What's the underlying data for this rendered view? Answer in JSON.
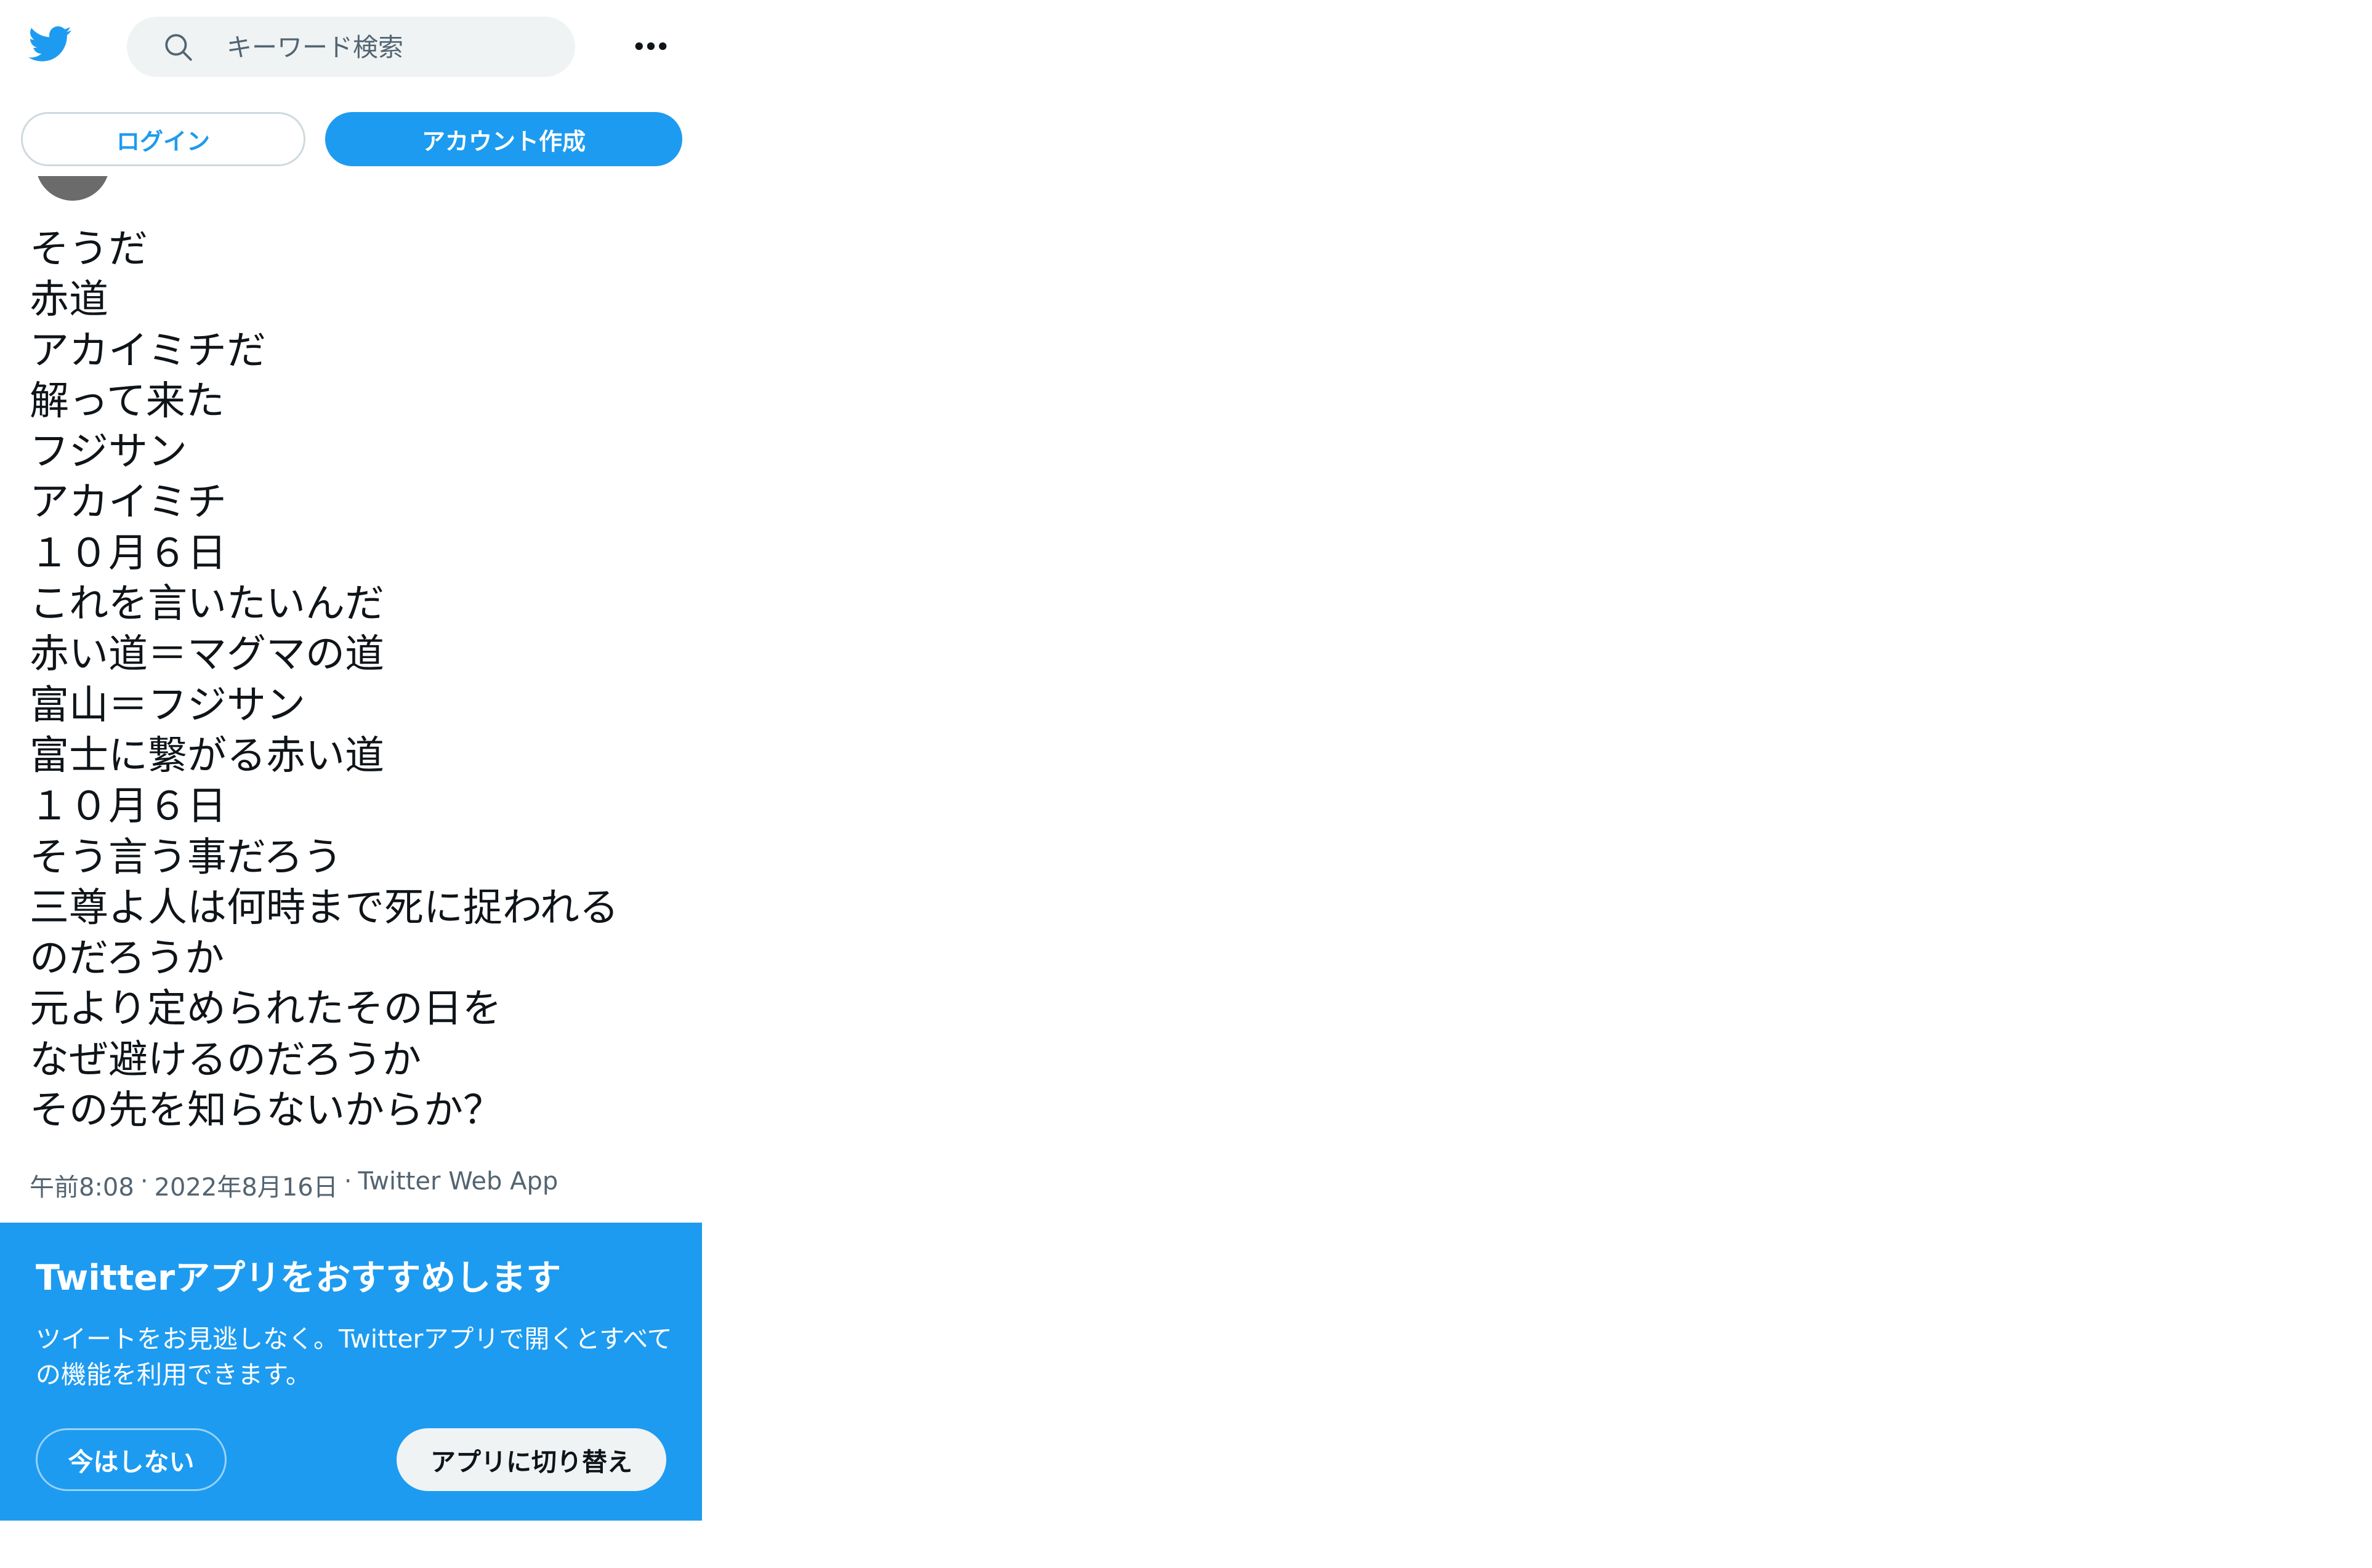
{
  "header": {
    "logo_icon": "twitter-bird-icon",
    "search_placeholder": "キーワード検索",
    "more_icon": "more-horizontal-icon"
  },
  "auth": {
    "login_label": "ログイン",
    "signup_label": "アカウント作成"
  },
  "tweet": {
    "lines": [
      "そうだ",
      "赤道",
      "アカイミチだ",
      "解って来た",
      "フジサン",
      "アカイミチ",
      "１０月６日",
      "これを言いたいんだ",
      "赤い道＝マグマの道",
      "富山＝フジサン",
      "富士に繋がる赤い道",
      "１０月６日",
      "そう言う事だろう",
      "三尊よ人は何時まで死に捉われる",
      "のだろうか",
      "元より定められたその日を",
      "なぜ避けるのだろうか",
      "その先を知らないからか？"
    ],
    "time": "午前8:08",
    "date": "2022年8月16日",
    "source": "Twitter Web App",
    "separator": "·"
  },
  "app_banner": {
    "title": "Twitterアプリをおすすめします",
    "body": "ツイートをお見逃しなく。Twitterアプリで開くとすべての機能を利用できます。",
    "not_now_label": "今はしない",
    "switch_label": "アプリに切り替え"
  },
  "colors": {
    "brand": "#1d9bf0",
    "text": "#0f1419",
    "muted": "#536471",
    "search_bg": "#eff3f4"
  }
}
